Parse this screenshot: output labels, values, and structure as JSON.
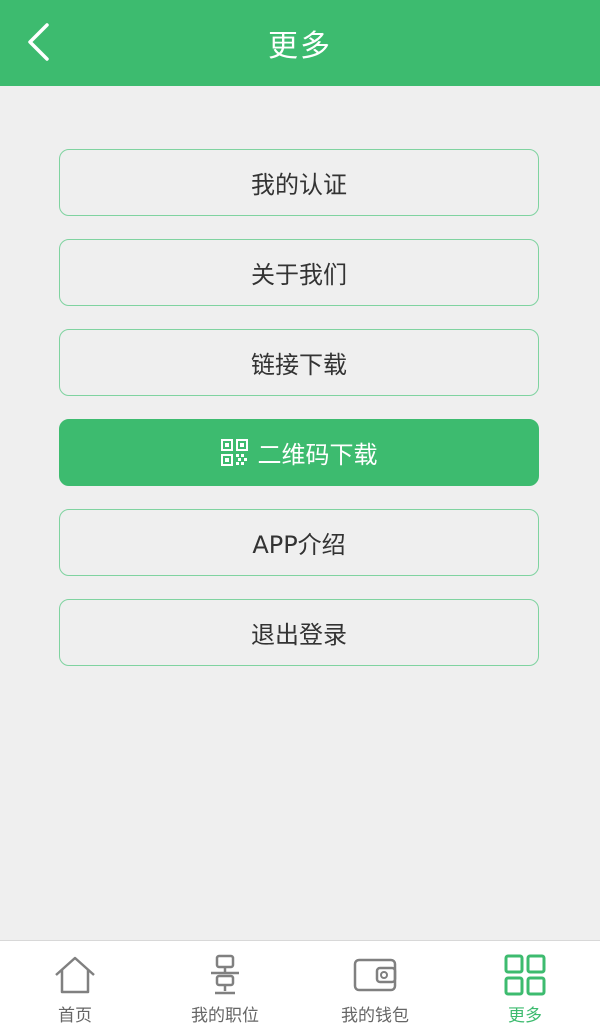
{
  "header": {
    "title": "更多",
    "back_icon": "chevron-left-icon"
  },
  "menu": {
    "items": [
      {
        "label": "我的认证"
      },
      {
        "label": "关于我们"
      },
      {
        "label": "链接下载"
      },
      {
        "label": "二维码下载",
        "icon": "qr-code-icon",
        "highlighted": true
      },
      {
        "label": "APP介绍"
      },
      {
        "label": "退出登录"
      }
    ]
  },
  "tabbar": {
    "tabs": [
      {
        "label": "首页",
        "icon": "home-icon"
      },
      {
        "label": "我的职位",
        "icon": "position-icon"
      },
      {
        "label": "我的钱包",
        "icon": "wallet-icon"
      },
      {
        "label": "更多",
        "icon": "grid-icon",
        "active": true
      }
    ]
  },
  "colors": {
    "primary": "#3dbb6f",
    "background": "#efefef",
    "text": "#333333",
    "inactive_tab": "#666666"
  }
}
